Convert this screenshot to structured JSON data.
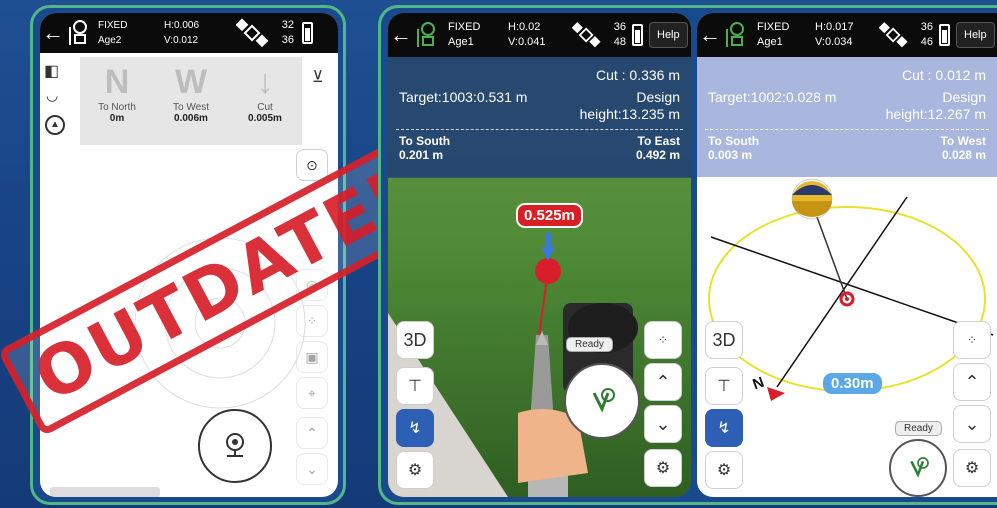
{
  "stamp_text": "OUTDATED",
  "phone_old": {
    "status": {
      "fix": "FIXED",
      "age": "Age2",
      "h": "H:0.006",
      "v": "V:0.012",
      "sats_top": "32",
      "sats_bottom": "36"
    },
    "cards": [
      {
        "letter": "N",
        "label": "To North",
        "value": "0m"
      },
      {
        "letter": "W",
        "label": "To West",
        "value": "0.006m"
      },
      {
        "letter": "↓",
        "label": "Cut",
        "value": "0.005m"
      }
    ]
  },
  "phone_ar": {
    "status": {
      "fix": "FIXED",
      "age": "Age1",
      "h": "H:0.02",
      "v": "V:0.041",
      "sats_top": "36",
      "sats_bottom": "48",
      "help": "Help"
    },
    "cut": "Cut : 0.336 m",
    "target": "Target:1003:0.531 m",
    "design": "Design height:13.235 m",
    "dir1_label": "To South",
    "dir1_value": "0.201 m",
    "dir2_label": "To East",
    "dir2_value": "0.492 m",
    "distance_label": "0.525m",
    "ready": "Ready",
    "btn_3d": "3D"
  },
  "phone_plan": {
    "status": {
      "fix": "FIXED",
      "age": "Age1",
      "h": "H:0.017",
      "v": "V:0.034",
      "sats_top": "36",
      "sats_bottom": "46",
      "help": "Help"
    },
    "cut": "Cut : 0.012 m",
    "target": "Target:1002:0.028 m",
    "design": "Design height:12.267 m",
    "dir1_label": "To South",
    "dir1_value": "0.003 m",
    "dir2_label": "To West",
    "dir2_value": "0.028 m",
    "distance_label": "0.30m",
    "north": "N",
    "ready": "Ready",
    "btn_3d": "3D"
  },
  "colors": {
    "frame": "#52b788",
    "background": "#1a4a8e",
    "accent_blue": "#2d5fb5",
    "red": "#d91f26"
  }
}
